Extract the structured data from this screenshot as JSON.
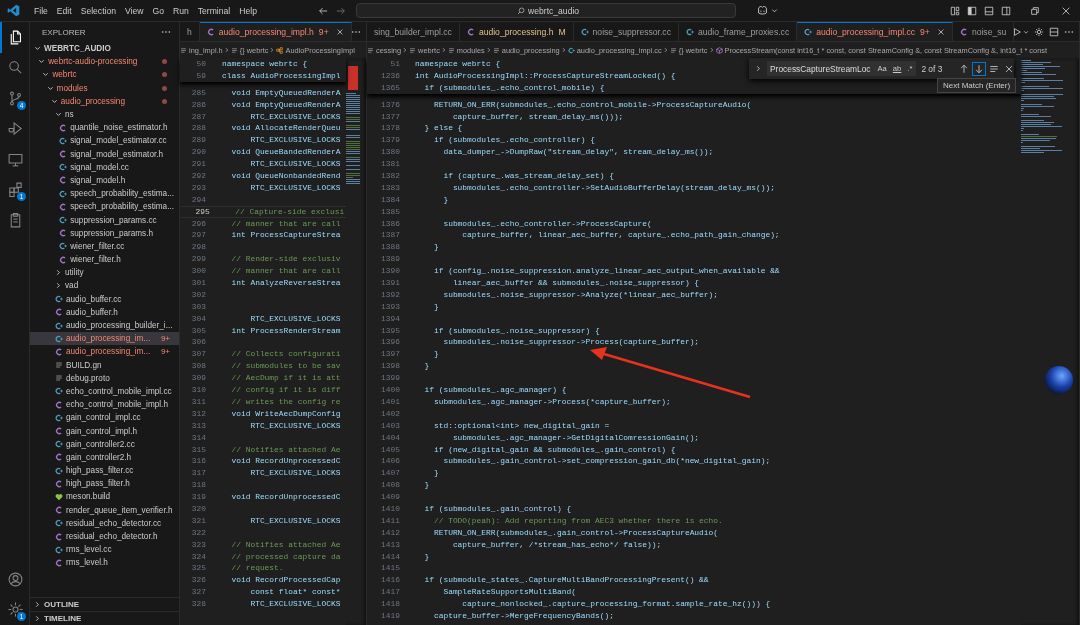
{
  "title_bar": {
    "menu": [
      "File",
      "Edit",
      "Selection",
      "View",
      "Go",
      "Run",
      "Terminal",
      "Help"
    ],
    "search": "webrtc_audio"
  },
  "activity_bar": {
    "top": [
      {
        "selected": true
      },
      {
        "selected": false
      },
      {
        "selected": false,
        "badge": "4"
      },
      {
        "selected": false
      },
      {
        "selected": false
      },
      {
        "selected": false,
        "badge": "1"
      },
      {
        "selected": false
      }
    ],
    "bottom": [
      {
        "selected": false
      },
      {
        "selected": false,
        "badge": "1"
      }
    ]
  },
  "sidebar": {
    "title": "EXPLORER",
    "workspace": {
      "label": "WEBRTC_AUDIO",
      "expanded": true
    },
    "tree": [
      {
        "label": "webrtc-audio-processing",
        "kind": "folder",
        "expanded": true,
        "problems": true,
        "selected": false,
        "children": [
          {
            "label": "webrtc",
            "kind": "folder",
            "expanded": true,
            "problems": true,
            "selected": false,
            "children": [
              {
                "label": "modules",
                "kind": "folder",
                "expanded": true,
                "problems": true,
                "selected": false,
                "children": [
                  {
                    "label": "audio_processing",
                    "kind": "folder",
                    "expanded": true,
                    "problems": true,
                    "selected": false,
                    "children": [
                      {
                        "label": "ns",
                        "kind": "folder",
                        "expanded": true,
                        "problems": false,
                        "selected": false,
                        "children": [
                          {
                            "label": "quantile_noise_estimator.h",
                            "kind": "header",
                            "problems": false,
                            "selected": false
                          },
                          {
                            "label": "signal_model_estimator.cc",
                            "kind": "source",
                            "problems": false,
                            "selected": false
                          },
                          {
                            "label": "signal_model_estimator.h",
                            "kind": "header",
                            "problems": false,
                            "selected": false
                          },
                          {
                            "label": "signal_model.cc",
                            "kind": "source",
                            "problems": false,
                            "selected": false
                          },
                          {
                            "label": "signal_model.h",
                            "kind": "header",
                            "problems": false,
                            "selected": false
                          },
                          {
                            "label": "speech_probability_estima...",
                            "kind": "source",
                            "problems": false,
                            "selected": false
                          },
                          {
                            "label": "speech_probability_estima...",
                            "kind": "header",
                            "problems": false,
                            "selected": false
                          },
                          {
                            "label": "suppression_params.cc",
                            "kind": "source",
                            "problems": false,
                            "selected": false
                          },
                          {
                            "label": "suppression_params.h",
                            "kind": "header",
                            "problems": false,
                            "selected": false
                          },
                          {
                            "label": "wiener_filter.cc",
                            "kind": "source",
                            "problems": false,
                            "selected": false
                          },
                          {
                            "label": "wiener_filter.h",
                            "kind": "header",
                            "problems": false,
                            "selected": false
                          }
                        ]
                      },
                      {
                        "label": "utility",
                        "kind": "folder",
                        "expanded": false,
                        "problems": false,
                        "selected": false
                      },
                      {
                        "label": "vad",
                        "kind": "folder",
                        "expanded": false,
                        "problems": false,
                        "selected": false
                      },
                      {
                        "label": "audio_buffer.cc",
                        "kind": "source",
                        "problems": false,
                        "selected": false
                      },
                      {
                        "label": "audio_buffer.h",
                        "kind": "header",
                        "problems": false,
                        "selected": false
                      },
                      {
                        "label": "audio_processing_builder_i...",
                        "kind": "source",
                        "problems": false,
                        "selected": false
                      },
                      {
                        "label": "audio_processing_im...",
                        "kind": "source",
                        "problems": true,
                        "selected": true,
                        "badge": "9+"
                      },
                      {
                        "label": "audio_processing_im...",
                        "kind": "header",
                        "problems": true,
                        "selected": false,
                        "badge": "9+"
                      },
                      {
                        "label": "BUILD.gn",
                        "kind": "text",
                        "problems": false,
                        "selected": false
                      },
                      {
                        "label": "debug.proto",
                        "kind": "text",
                        "problems": false,
                        "selected": false
                      },
                      {
                        "label": "echo_control_mobile_impl.cc",
                        "kind": "source",
                        "problems": false,
                        "selected": false
                      },
                      {
                        "label": "echo_control_mobile_impl.h",
                        "kind": "header",
                        "problems": false,
                        "selected": false
                      },
                      {
                        "label": "gain_control_impl.cc",
                        "kind": "source",
                        "problems": false,
                        "selected": false
                      },
                      {
                        "label": "gain_control_impl.h",
                        "kind": "header",
                        "problems": false,
                        "selected": false
                      },
                      {
                        "label": "gain_controller2.cc",
                        "kind": "source",
                        "problems": false,
                        "selected": false
                      },
                      {
                        "label": "gain_controller2.h",
                        "kind": "header",
                        "problems": false,
                        "selected": false
                      },
                      {
                        "label": "high_pass_filter.cc",
                        "kind": "source",
                        "problems": false,
                        "selected": false
                      },
                      {
                        "label": "high_pass_filter.h",
                        "kind": "header",
                        "problems": false,
                        "selected": false
                      },
                      {
                        "label": "meson.build",
                        "kind": "meson",
                        "problems": false,
                        "selected": false
                      },
                      {
                        "label": "render_queue_item_verifier.h",
                        "kind": "header",
                        "problems": false,
                        "selected": false
                      },
                      {
                        "label": "residual_echo_detector.cc",
                        "kind": "source",
                        "problems": false,
                        "selected": false
                      },
                      {
                        "label": "residual_echo_detector.h",
                        "kind": "header",
                        "problems": false,
                        "selected": false
                      },
                      {
                        "label": "rms_level.cc",
                        "kind": "source",
                        "problems": false,
                        "selected": false
                      },
                      {
                        "label": "rms_level.h",
                        "kind": "header",
                        "problems": false,
                        "selected": false
                      }
                    ]
                  }
                ]
              }
            ]
          }
        ]
      }
    ],
    "sections": [
      {
        "label": "OUTLINE",
        "expanded": false
      },
      {
        "label": "TIMELINE",
        "expanded": false
      }
    ]
  },
  "editor_groups": [
    {
      "tabs": [
        {
          "label": "h",
          "kind": "none",
          "problems": false,
          "git_modified": false,
          "selected": false
        },
        {
          "label": "audio_processing_impl.h",
          "badge": "9+",
          "kind": "header",
          "problems": true,
          "git_modified": false,
          "selected": true
        }
      ],
      "breadcrumbs": [
        {
          "label": "ing_impl.h",
          "kind": "text"
        },
        {
          "label": "{} webrtc",
          "kind": "text"
        },
        {
          "label": "AudioProcessingImpl",
          "kind": "class"
        }
      ],
      "sticky_lines": [
        {
          "number": "50",
          "text": "namespace webrtc {"
        },
        {
          "number": "59",
          "text": "class AudioProcessingImpl"
        }
      ],
      "lines": [
        {
          "number": "285",
          "text": "  void EmptyQueuedRenderA",
          "kind": "code"
        },
        {
          "number": "286",
          "text": "  void EmptyQueuedRenderA",
          "kind": "code"
        },
        {
          "number": "287",
          "text": "      RTC_EXCLUSIVE_LOCKS",
          "kind": "code"
        },
        {
          "number": "288",
          "text": "  void AllocateRenderQueu",
          "kind": "code"
        },
        {
          "number": "289",
          "text": "      RTC_EXCLUSIVE_LOCKS",
          "kind": "code"
        },
        {
          "number": "290",
          "text": "  void QueueBandedRenderA",
          "kind": "code"
        },
        {
          "number": "291",
          "text": "      RTC_EXCLUSIVE_LOCKS",
          "kind": "code"
        },
        {
          "number": "292",
          "text": "  void QueueNonbandedRend",
          "kind": "code"
        },
        {
          "number": "293",
          "text": "      RTC_EXCLUSIVE_LOCKS",
          "kind": "code"
        },
        {
          "number": "294",
          "kind": "blank"
        },
        {
          "number": "295",
          "text": "  // Capture-side exclusi",
          "kind": "comment",
          "current": true
        },
        {
          "number": "296",
          "text": "  // manner that are call",
          "kind": "comment"
        },
        {
          "number": "297",
          "text": "  int ProcessCaptureStrea",
          "kind": "code"
        },
        {
          "number": "298",
          "kind": "blank"
        },
        {
          "number": "299",
          "text": "  // Render-side exclusiv",
          "kind": "comment"
        },
        {
          "number": "300",
          "text": "  // manner that are call",
          "kind": "comment"
        },
        {
          "number": "301",
          "text": "  int AnalyzeReverseStrea",
          "kind": "code"
        },
        {
          "number": "302",
          "kind": "blank"
        },
        {
          "number": "303",
          "kind": "blank"
        },
        {
          "number": "304",
          "text": "      RTC_EXCLUSIVE_LOCKS",
          "kind": "code"
        },
        {
          "number": "305",
          "text": "  int ProcessRenderStream",
          "kind": "code"
        },
        {
          "number": "306",
          "kind": "blank"
        },
        {
          "number": "307",
          "text": "  // Collects configurati",
          "kind": "comment"
        },
        {
          "number": "308",
          "text": "  // submodules to be sav",
          "kind": "comment"
        },
        {
          "number": "309",
          "text": "  // AecDump if it is att",
          "kind": "comment"
        },
        {
          "number": "310",
          "text": "  // config if it is diff",
          "kind": "comment"
        },
        {
          "number": "311",
          "text": "  // writes the config re",
          "kind": "comment"
        },
        {
          "number": "312",
          "text": "  void WriteAecDumpConfig",
          "kind": "code"
        },
        {
          "number": "313",
          "text": "      RTC_EXCLUSIVE_LOCKS",
          "kind": "code"
        },
        {
          "number": "314",
          "kind": "blank"
        },
        {
          "number": "315",
          "text": "  // Notifies attached Ae",
          "kind": "comment"
        },
        {
          "number": "316",
          "text": "  void RecordUnprocessedC",
          "kind": "code"
        },
        {
          "number": "317",
          "text": "      RTC_EXCLUSIVE_LOCKS",
          "kind": "code"
        },
        {
          "number": "318",
          "kind": "blank"
        },
        {
          "number": "319",
          "text": "  void RecordUnprocessedC",
          "kind": "code"
        },
        {
          "number": "320",
          "kind": "blank"
        },
        {
          "number": "321",
          "text": "      RTC_EXCLUSIVE_LOCKS",
          "kind": "code"
        },
        {
          "number": "322",
          "kind": "blank"
        },
        {
          "number": "323",
          "text": "  // Notifies attached Ae",
          "kind": "comment"
        },
        {
          "number": "324",
          "text": "  // processed capture da",
          "kind": "comment"
        },
        {
          "number": "325",
          "text": "  // request.",
          "kind": "comment"
        },
        {
          "number": "326",
          "text": "  void RecordProcessedCap",
          "kind": "code"
        },
        {
          "number": "327",
          "text": "      const float* const*",
          "kind": "code"
        },
        {
          "number": "328",
          "text": "      RTC_EXCLUSIVE_LOCKS",
          "kind": "code"
        }
      ]
    },
    {
      "tabs": [
        {
          "label": "sing_builder_impl.cc",
          "kind": "none",
          "problems": false,
          "git_modified": false,
          "selected": false
        },
        {
          "label": "audio_processing.h",
          "badge": "M",
          "kind": "header",
          "problems": false,
          "git_modified": true,
          "selected": false
        },
        {
          "label": "noise_suppressor.cc",
          "kind": "source",
          "problems": false,
          "git_modified": false,
          "selected": false
        },
        {
          "label": "audio_frame_proxies.cc",
          "kind": "source",
          "problems": false,
          "git_modified": false,
          "selected": false
        },
        {
          "label": "audio_processing_impl.cc",
          "badge": "9+",
          "kind": "source",
          "problems": true,
          "git_modified": false,
          "selected": true
        },
        {
          "label": "noise_su",
          "kind": "header",
          "problems": false,
          "git_modified": false,
          "selected": false
        }
      ],
      "breadcrumbs": [
        {
          "label": "cessing",
          "kind": "text"
        },
        {
          "label": "webrtc",
          "kind": "text"
        },
        {
          "label": "modules",
          "kind": "text"
        },
        {
          "label": "audio_processing",
          "kind": "text"
        },
        {
          "label": "audio_processing_impl.cc",
          "kind": "file"
        },
        {
          "label": "{} webrtc",
          "kind": "text"
        },
        {
          "label": "ProcessStream(const int16_t * const, const StreamConfig &, const StreamConfig &, int16_t * const",
          "kind": "method"
        }
      ],
      "find": {
        "query": "ProcessCaptureStreamLoc",
        "options": [
          {
            "label": "Aa",
            "kind": "case",
            "on": false
          },
          {
            "label": "ab",
            "kind": "word",
            "on": false
          },
          {
            "label": ".*",
            "kind": "regex",
            "on": false
          }
        ],
        "count": "2 of 3",
        "tooltip": "Next Match (Enter)"
      },
      "sticky_lines": [
        {
          "number": "51",
          "text": "namespace webrtc {"
        },
        {
          "number": "1236",
          "text": "int AudioProcessingImpl::ProcessCaptureStreamLocked() {"
        },
        {
          "number": "1365",
          "text": "  if (submodules_.echo_control_mobile) {"
        }
      ],
      "lines": [
        {
          "number": "1376",
          "text": "    RETURN_ON_ERR(submodules_.echo_control_mobile->ProcessCaptureAudio(",
          "kind": "code"
        },
        {
          "number": "1377",
          "text": "        capture_buffer, stream_delay_ms()));",
          "kind": "code"
        },
        {
          "number": "1378",
          "text": "  } else {",
          "kind": "code"
        },
        {
          "number": "1379",
          "text": "    if (submodules_.echo_controller) {",
          "kind": "code"
        },
        {
          "number": "1380",
          "text": "      data_dumper_->DumpRaw(\"stream_delay\", stream_delay_ms());",
          "kind": "code"
        },
        {
          "number": "1381",
          "kind": "blank"
        },
        {
          "number": "1382",
          "text": "      if (capture_.was_stream_delay_set) {",
          "kind": "code"
        },
        {
          "number": "1383",
          "text": "        submodules_.echo_controller->SetAudioBufferDelay(stream_delay_ms());",
          "kind": "code"
        },
        {
          "number": "1384",
          "text": "      }",
          "kind": "code"
        },
        {
          "number": "1385",
          "kind": "blank"
        },
        {
          "number": "1386",
          "text": "      submodules_.echo_controller->ProcessCapture(",
          "kind": "code"
        },
        {
          "number": "1387",
          "text": "          capture_buffer, linear_aec_buffer, capture_.echo_path_gain_change);",
          "kind": "code"
        },
        {
          "number": "1388",
          "text": "    }",
          "kind": "code"
        },
        {
          "number": "1389",
          "kind": "blank"
        },
        {
          "number": "1390",
          "text": "    if (config_.noise_suppression.analyze_linear_aec_output_when_available &&",
          "kind": "code"
        },
        {
          "number": "1391",
          "text": "        linear_aec_buffer && submodules_.noise_suppressor) {",
          "kind": "code"
        },
        {
          "number": "1392",
          "text": "      submodules_.noise_suppressor->Analyze(*linear_aec_buffer);",
          "kind": "code"
        },
        {
          "number": "1393",
          "text": "    }",
          "kind": "code"
        },
        {
          "number": "1394",
          "kind": "blank"
        },
        {
          "number": "1395",
          "text": "    if (submodules_.noise_suppressor) {",
          "kind": "code"
        },
        {
          "number": "1396",
          "text": "      submodules_.noise_suppressor->Process(capture_buffer);",
          "kind": "code"
        },
        {
          "number": "1397",
          "text": "    }",
          "kind": "code"
        },
        {
          "number": "1398",
          "text": "  }",
          "kind": "code"
        },
        {
          "number": "1399",
          "kind": "blank"
        },
        {
          "number": "1400",
          "text": "  if (submodules_.agc_manager) {",
          "kind": "code"
        },
        {
          "number": "1401",
          "text": "    submodules_.agc_manager->Process(*capture_buffer);",
          "kind": "code"
        },
        {
          "number": "1402",
          "kind": "blank"
        },
        {
          "number": "1403",
          "text": "    std::optional<int> new_digital_gain =",
          "kind": "code"
        },
        {
          "number": "1404",
          "text": "        submodules_.agc_manager->GetDigitalComressionGain();",
          "kind": "code"
        },
        {
          "number": "1405",
          "text": "    if (new_digital_gain && submodules_.gain_control) {",
          "kind": "code"
        },
        {
          "number": "1406",
          "text": "      submodules_.gain_control->set_compression_gain_db(*new_digital_gain);",
          "kind": "code"
        },
        {
          "number": "1407",
          "text": "    }",
          "kind": "code"
        },
        {
          "number": "1408",
          "text": "  }",
          "kind": "code"
        },
        {
          "number": "1409",
          "kind": "blank"
        },
        {
          "number": "1410",
          "text": "  if (submodules_.gain_control) {",
          "kind": "code"
        },
        {
          "number": "1411",
          "text": "    // TODO(peah): Add reporting from AEC3 whether there is echo.",
          "kind": "comment"
        },
        {
          "number": "1412",
          "text": "    RETURN_ON_ERR(submodules_.gain_control->ProcessCaptureAudio(",
          "kind": "code"
        },
        {
          "number": "1413",
          "text": "        capture_buffer, /*stream_has_echo*/ false));",
          "kind": "code"
        },
        {
          "number": "1414",
          "text": "  }",
          "kind": "code"
        },
        {
          "number": "1415",
          "kind": "blank"
        },
        {
          "number": "1416",
          "text": "  if (submodule_states_.CaptureMultiBandProcessingPresent() &&",
          "kind": "code"
        },
        {
          "number": "1417",
          "text": "      SampleRateSupportsMultiBand(",
          "kind": "code"
        },
        {
          "number": "1418",
          "text": "          capture_nonlocked_.capture_processing_format.sample_rate_hz())) {",
          "kind": "code"
        },
        {
          "number": "1419",
          "text": "    capture_buffer->MergeFrequencyBands();",
          "kind": "code"
        }
      ]
    }
  ]
}
